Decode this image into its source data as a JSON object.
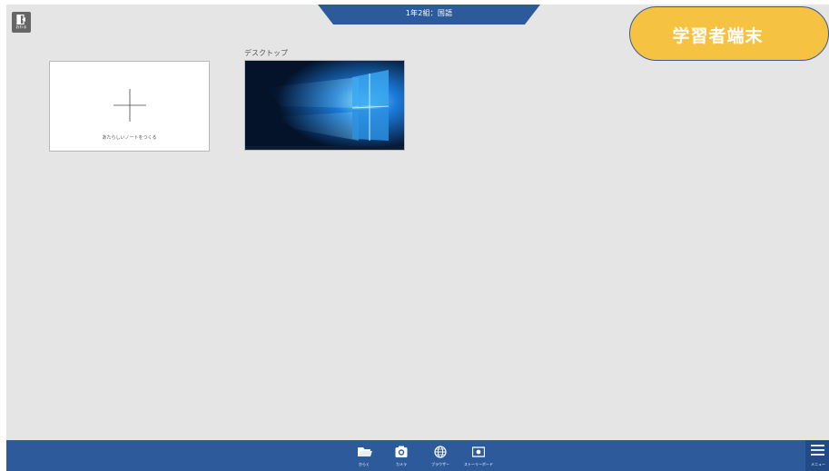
{
  "header": {
    "class_name": "1年2組：国語",
    "exit_label": "おわる",
    "role_badge": "学習者端末"
  },
  "notes": {
    "new_note_label": "あたらしいノートをつくる",
    "desktop_label": "デスクトップ"
  },
  "toolbar": {
    "open_label": "ひらく",
    "camera_label": "カメラ",
    "browser_label": "ブラウザー",
    "storyboard_label": "ストーリーボード",
    "menu_label": "メニュー"
  },
  "colors": {
    "accent": "#2d5a9b",
    "badge": "#f6c242",
    "background": "#e5e5e5"
  }
}
